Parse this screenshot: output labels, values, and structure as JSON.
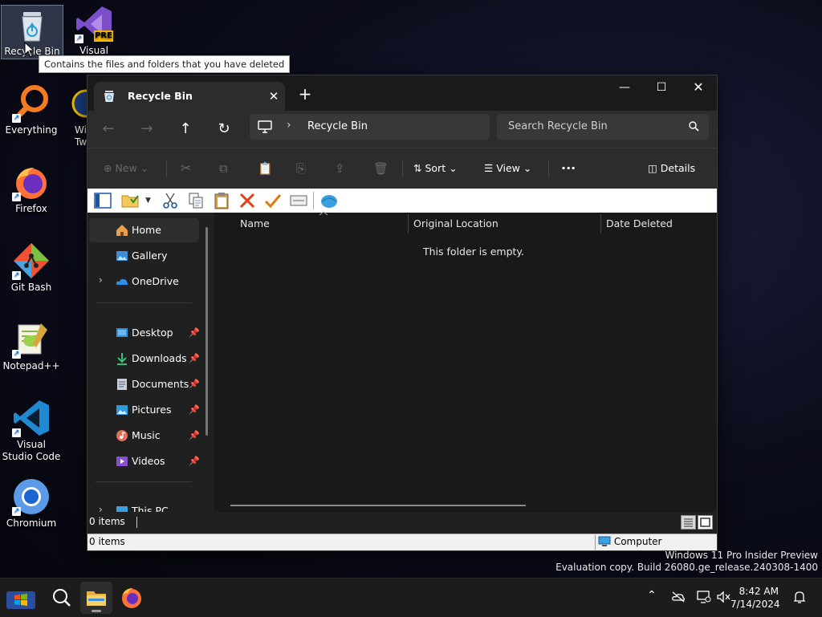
{
  "desktop": {
    "icons": [
      {
        "label": "Recycle Bin",
        "icon": "recycle-bin-icon"
      },
      {
        "label": "Visual Studio",
        "icon": "visual-studio-icon",
        "badge": "PRE"
      },
      {
        "label": "Everything",
        "icon": "everything-search-icon"
      },
      {
        "label": "Wi Tw",
        "icon": "partially-hidden-app-icon"
      },
      {
        "label": "Firefox",
        "icon": "firefox-icon"
      },
      {
        "label": "Git Bash",
        "icon": "git-bash-icon"
      },
      {
        "label": "Notepad++",
        "icon": "notepad-plus-plus-icon"
      },
      {
        "label": "Visual Studio Code",
        "icon": "vscode-icon"
      },
      {
        "label": "Chromium",
        "icon": "chromium-icon"
      }
    ],
    "tooltip": "Contains the files and folders that you have deleted"
  },
  "window": {
    "tab_title": "Recycle Bin",
    "address": {
      "location": "Recycle Bin"
    },
    "search": {
      "placeholder": "Search Recycle Bin"
    },
    "commands": {
      "new": "New",
      "sort": "Sort",
      "view": "View",
      "details": "Details"
    },
    "sidebar": {
      "items": [
        {
          "label": "Home",
          "icon": "home-icon",
          "selected": true
        },
        {
          "label": "Gallery",
          "icon": "gallery-icon"
        },
        {
          "label": "OneDrive",
          "icon": "onedrive-icon"
        },
        {
          "label": "Desktop",
          "icon": "desktop-folder-icon",
          "pinned": true
        },
        {
          "label": "Downloads",
          "icon": "downloads-icon",
          "pinned": true
        },
        {
          "label": "Documents",
          "icon": "documents-icon",
          "pinned": true
        },
        {
          "label": "Pictures",
          "icon": "pictures-icon",
          "pinned": true
        },
        {
          "label": "Music",
          "icon": "music-icon",
          "pinned": true
        },
        {
          "label": "Videos",
          "icon": "videos-icon",
          "pinned": true
        },
        {
          "label": "This PC",
          "icon": "this-pc-icon"
        }
      ]
    },
    "columns": [
      "Name",
      "Original Location",
      "Date Deleted"
    ],
    "empty_message": "This folder is empty.",
    "status": {
      "items": "0 items"
    },
    "classic_status": {
      "items": "0 items",
      "zone": "Computer"
    }
  },
  "watermark": {
    "line1": "Windows 11 Pro Insider Preview",
    "line2": "Evaluation copy. Build 26080.ge_release.240308-1400"
  },
  "taskbar": {
    "time": "8:42 AM",
    "date": "7/14/2024"
  },
  "colors": {
    "accent": "#4cc2ff",
    "window_bg": "#202020",
    "toolbar_bg": "#2c2c2c"
  }
}
